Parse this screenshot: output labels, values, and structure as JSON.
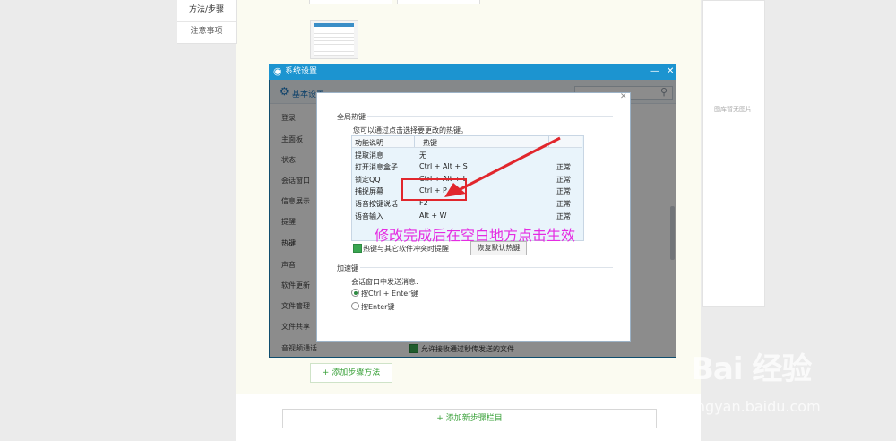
{
  "left_nav": {
    "items": [
      {
        "label": "方法/步骤"
      },
      {
        "label": "注意事项"
      }
    ]
  },
  "gallery": {
    "empty_text": "图库暂无图片"
  },
  "settings_window": {
    "title": "系统设置",
    "toolbar": {
      "active_tab": "基本设置"
    },
    "side_menu": [
      "登录",
      "主面板",
      "状态",
      "会话窗口",
      "信息展示",
      "提醒",
      "热键",
      "声音",
      "软件更新",
      "文件管理",
      "文件共享",
      "音视频通话"
    ],
    "active_side_item": "热键",
    "bottom_option": "允许接收通过秒传发送的文件"
  },
  "dialog": {
    "global_hotkeys": {
      "heading": "全局热键",
      "description": "您可以通过点击选择要更改的热键。",
      "columns": [
        "功能说明",
        "热键",
        ""
      ],
      "rows": [
        {
          "name": "提取消息",
          "key": "无",
          "status": ""
        },
        {
          "name": "打开消息盒子",
          "key": "Ctrl + Alt + S",
          "status": "正常"
        },
        {
          "name": "锁定QQ",
          "key": "Ctrl + Alt + L",
          "status": "正常"
        },
        {
          "name": "捕捉屏幕",
          "key": "Ctrl + P",
          "status": "正常"
        },
        {
          "name": "语音按键说话",
          "key": "F2",
          "status": "正常"
        },
        {
          "name": "语音输入",
          "key": "Alt + W",
          "status": "正常"
        }
      ],
      "conflict_checkbox": "热键与其它软件冲突时提醒",
      "restore_button": "恢复默认热键"
    },
    "accelerator": {
      "heading": "加速键",
      "description": "会话窗口中发送消息:",
      "options": [
        {
          "label": "按Ctrl + Enter键",
          "selected": true
        },
        {
          "label": "按Enter键",
          "selected": false
        }
      ]
    }
  },
  "annotation": {
    "hint": "修改完成后在空白地方点击生效"
  },
  "page_buttons": {
    "add_step": "+ 添加步骤方法",
    "add_section": "+ 添加新步骤栏目"
  },
  "watermark": {
    "logo": "Bai 经验",
    "url": "jingyan.baidu.com"
  },
  "colors": {
    "accent": "#1c94d0",
    "hint": "#e52ce2",
    "highlight": "#e1262c",
    "green": "#3aa13a"
  }
}
